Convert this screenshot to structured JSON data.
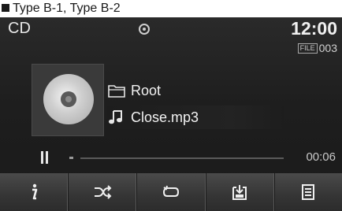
{
  "caption": {
    "text": "Type B-1, Type B-2"
  },
  "status_bar": {
    "source": "CD",
    "time": "12:00"
  },
  "file_indicator": {
    "badge": "FILE",
    "number": "003"
  },
  "track": {
    "folder": "Root",
    "filename": "Close.mp3"
  },
  "playback": {
    "state": "paused",
    "elapsed": "00:06",
    "progress": 0.0
  },
  "softkeys": [
    {
      "icon": "info-icon"
    },
    {
      "icon": "shuffle-icon"
    },
    {
      "icon": "repeat-icon"
    },
    {
      "icon": "copy-icon"
    },
    {
      "icon": "list-icon"
    }
  ]
}
